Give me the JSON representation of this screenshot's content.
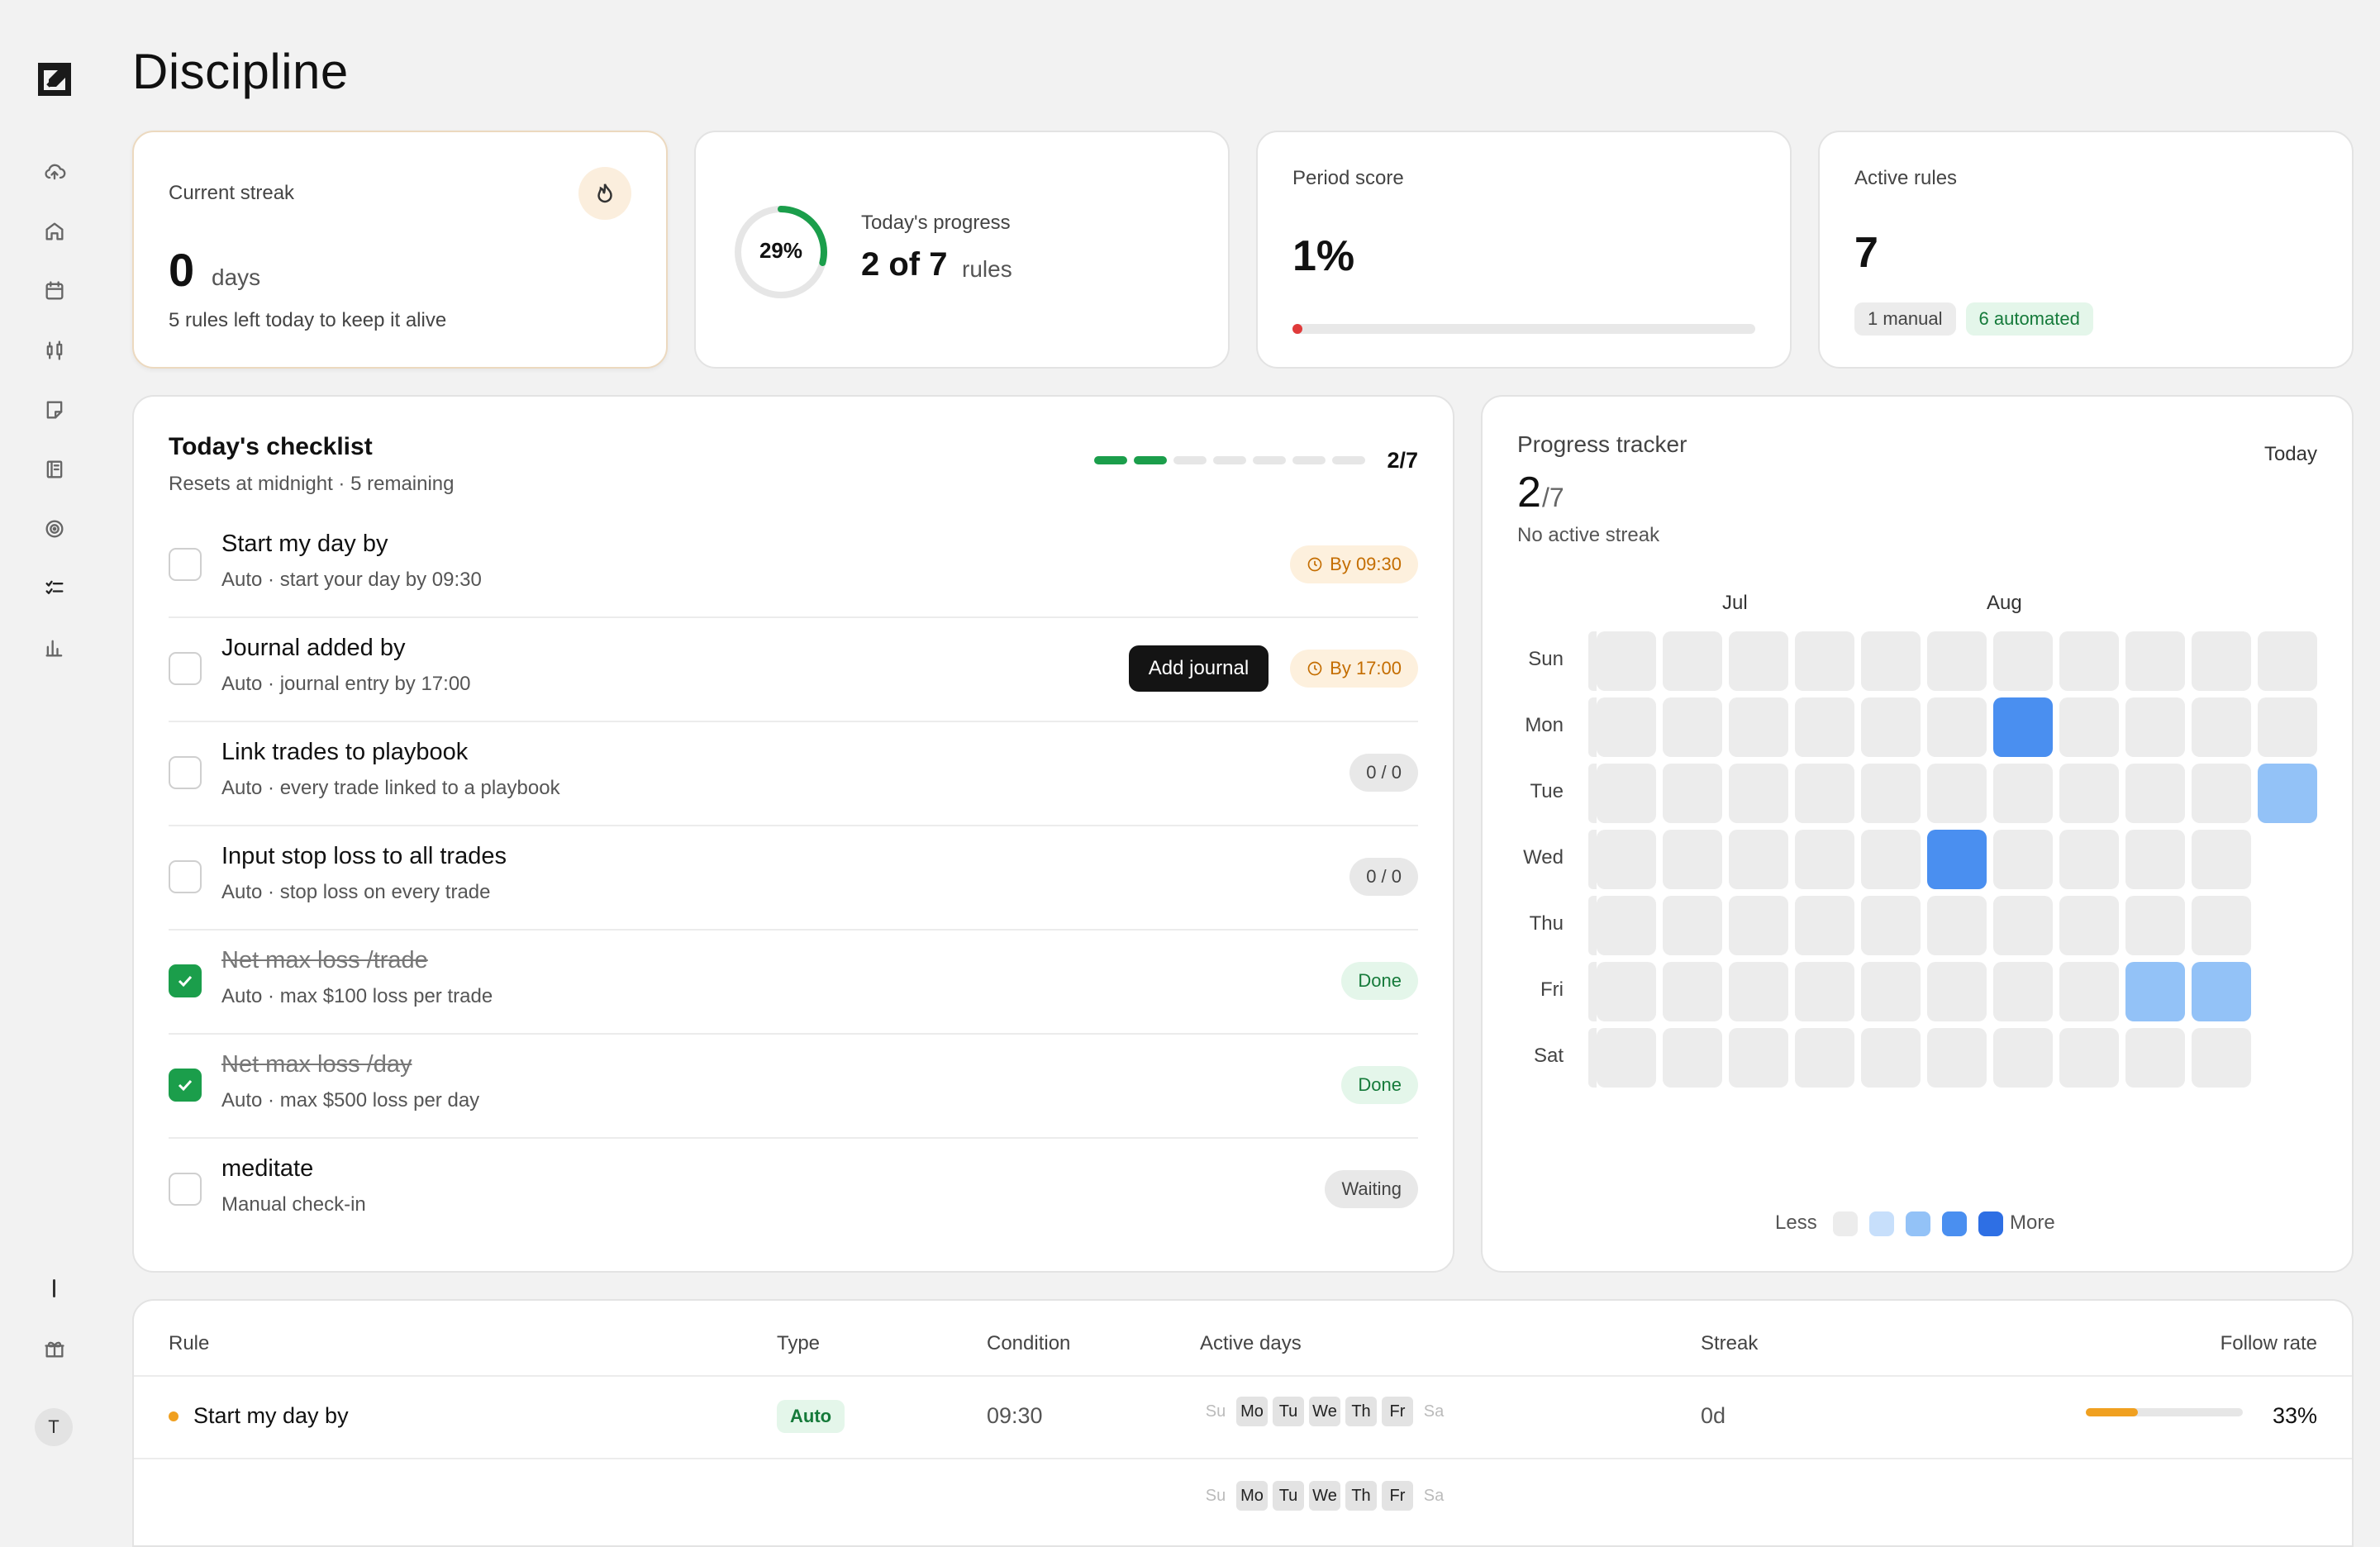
{
  "page": {
    "title": "Discipline"
  },
  "sidebar": {
    "icons": [
      "cloud-upload-icon",
      "home-icon",
      "calendar-icon",
      "candlestick-icon",
      "note-icon",
      "book-icon",
      "target-icon",
      "checklist-icon",
      "bar-chart-icon"
    ],
    "bottom": [
      "gift-icon"
    ],
    "avatar_initial": "T"
  },
  "streak": {
    "label": "Current streak",
    "value": "0",
    "unit": "days",
    "sub": "5 rules left today to keep it alive"
  },
  "today": {
    "percent_label": "29%",
    "percent": 0.29,
    "label": "Today's progress",
    "count": "2 of 7",
    "unit": "rules"
  },
  "period": {
    "label": "Period score",
    "value": "1%",
    "fraction": 0.01
  },
  "active_rules": {
    "label": "Active rules",
    "value": "7",
    "manual": "1 manual",
    "automated": "6 automated"
  },
  "checklist": {
    "title": "Today's checklist",
    "sub": "Resets at midnight · 5 remaining",
    "count": "2/7",
    "segments_done": 2,
    "segments_total": 7,
    "items": [
      {
        "title": "Start my day by",
        "sub": "Auto · start your day by 09:30",
        "checked": false,
        "status": "By 09:30",
        "status_type": "amber"
      },
      {
        "title": "Journal added by",
        "sub": "Auto · journal entry by 17:00",
        "checked": false,
        "status": "By 17:00",
        "status_type": "amber",
        "action": "Add journal"
      },
      {
        "title": "Link trades to playbook",
        "sub": "Auto · every trade linked to a playbook",
        "checked": false,
        "status": "0 / 0",
        "status_type": "gray"
      },
      {
        "title": "Input stop loss to all trades",
        "sub": "Auto · stop loss on every trade",
        "checked": false,
        "status": "0 / 0",
        "status_type": "gray"
      },
      {
        "title": "Net max loss /trade",
        "sub": "Auto · max $100 loss per trade",
        "checked": true,
        "status": "Done",
        "status_type": "green"
      },
      {
        "title": "Net max loss /day",
        "sub": "Auto · max $500 loss per day",
        "checked": true,
        "status": "Done",
        "status_type": "green"
      },
      {
        "title": "meditate",
        "sub": "Manual check-in",
        "checked": false,
        "status": "Waiting",
        "status_type": "gray"
      }
    ]
  },
  "tracker": {
    "title": "Progress tracker",
    "today_button": "Today",
    "value": "2",
    "total": "/7",
    "sub": "No active streak",
    "months": [
      "Jul",
      "Aug"
    ],
    "days": [
      "Sun",
      "Mon",
      "Tue",
      "Wed",
      "Thu",
      "Fri",
      "Sat"
    ],
    "legend_less": "Less",
    "legend_more": "More",
    "legend_colors": [
      "#ececec",
      "#c7dffb",
      "#93c2f7",
      "#4a8ff0",
      "#2e6fe4"
    ],
    "highlighted": [
      {
        "week": 6,
        "day": 1,
        "level": 3
      },
      {
        "week": 10,
        "day": 2,
        "level": 2
      },
      {
        "week": 5,
        "day": 3,
        "level": 3
      },
      {
        "week": 8,
        "day": 5,
        "level": 2
      },
      {
        "week": 9,
        "day": 5,
        "level": 2
      }
    ]
  },
  "table": {
    "headers": {
      "rule": "Rule",
      "type": "Type",
      "condition": "Condition",
      "active_days": "Active days",
      "streak": "Streak",
      "follow": "Follow rate"
    },
    "rows": [
      {
        "rule": "Start my day by",
        "type": "Auto",
        "condition": "09:30",
        "days": [
          "Su",
          "Mo",
          "Tu",
          "We",
          "Th",
          "Fr",
          "Sa"
        ],
        "active": [
          false,
          true,
          true,
          true,
          true,
          true,
          false
        ],
        "streak": "0d",
        "follow": "33%",
        "follow_fraction": 0.33
      }
    ]
  }
}
